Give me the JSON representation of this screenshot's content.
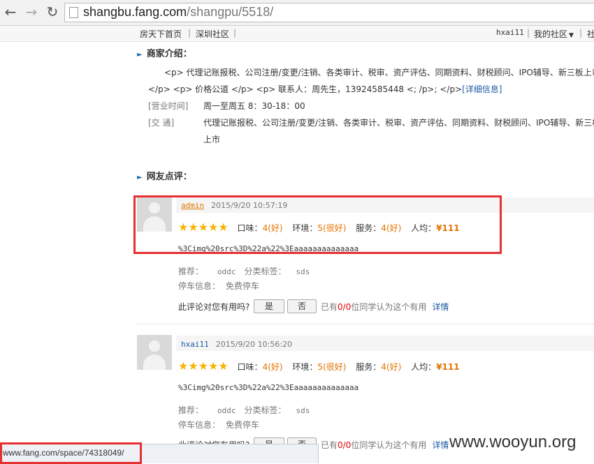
{
  "browser": {
    "url_host": "shangbu.fang.com",
    "url_path": "/shangpu/5518/",
    "status_url": "www.fang.com/space/74318049/"
  },
  "sitenav": {
    "home": "房天下首页",
    "sep1": "|",
    "city": "深圳社区",
    "sep2": "|",
    "user": "hxai11",
    "sep3": "|",
    "my_community": "我的社区",
    "my_community_arrow": "▼",
    "sep4": "|",
    "next": "社"
  },
  "merchant": {
    "title": "商家介绍：",
    "intro_line1": "<p> 代理记账报税、公司注册/变更/注销、各类审计、税审、资产评估、同期资料、财税顾问、IPO辅导、新三板上市",
    "intro_line2": "</p> <p> 价格公道 </p> <p> 联系人：周先生，13924585448   <; /p>; </p>",
    "detail_link": "[详细信息]",
    "hours_label": "[营业时间]",
    "hours_value": "周一至周五 8：30-18：00",
    "traffic_label": "[交    通]",
    "traffic_line1": "代理记账报税、公司注册/变更/注销、各类审计、税审、资产评估、同期资料、财税顾问、IPO辅导、新三板",
    "traffic_line2": "上市"
  },
  "comments_title": "网友点评：",
  "reviews": [
    {
      "user": "admin",
      "time": "2015/9/20 10:57:19",
      "taste_label": "口味：",
      "taste": "4",
      "taste_desc": "(好)",
      "env_label": "环境：",
      "env": "5",
      "env_desc": "(很好)",
      "service_label": "服务：",
      "service": "4",
      "service_desc": "(好)",
      "avg_label": "人均：",
      "avg": "¥111",
      "content": "%3Cimg%20src%3D%22a%22%3Eaaaaaaaaaaaaaa",
      "recommend_label": "推荐：",
      "recommend": "oddc",
      "tag_label": "分类标签：",
      "tag": "sds",
      "parking_label": "停车信息：",
      "parking": "免费停车",
      "useful_q": "此评论对您有用吗?",
      "yes": "是",
      "no": "否",
      "useful_pre": "已有",
      "useful_count": "0/0",
      "useful_post": "位同学认为这个有用",
      "detail": "详情"
    },
    {
      "user": "hxai11",
      "time": "2015/9/20 10:56:20",
      "taste_label": "口味：",
      "taste": "4",
      "taste_desc": "(好)",
      "env_label": "环境：",
      "env": "5",
      "env_desc": "(很好)",
      "service_label": "服务：",
      "service": "4",
      "service_desc": "(好)",
      "avg_label": "人均：",
      "avg": "¥111",
      "content": "%3Cimg%20src%3D%22a%22%3Eaaaaaaaaaaaaaa",
      "recommend_label": "推荐：",
      "recommend": "oddc",
      "tag_label": "分类标签：",
      "tag": "sds",
      "parking_label": "停车信息：",
      "parking": "免费停车",
      "useful_q": "此评论对您有用吗?",
      "yes": "是",
      "no": "否",
      "useful_pre": "已有",
      "useful_count": "0/0",
      "useful_post": "位同学认为这个有用",
      "detail": "详情"
    }
  ],
  "stars": "★★★★★",
  "watermark": "www.wooyun.org",
  "colors": {
    "highlight_box": "#e53030",
    "accent": "#e37400",
    "link": "#1a5aa6"
  }
}
